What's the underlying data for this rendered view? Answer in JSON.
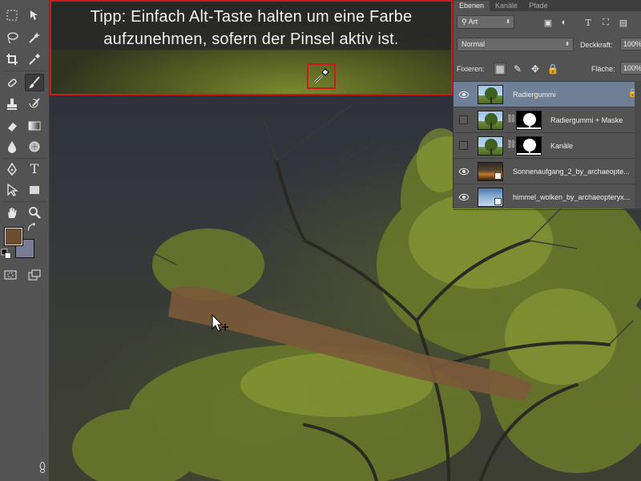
{
  "tip": {
    "line1": "Tipp: Einfach Alt-Taste halten um eine Farbe",
    "line2": "aufzunehmen, sofern der Pinsel aktiv ist."
  },
  "tools": {
    "foreground_color": "#6a4e30",
    "background_color": "#787c95",
    "items": [
      {
        "name": "marquee-tool-icon"
      },
      {
        "name": "move-tool-icon"
      },
      {
        "name": "lasso-tool-icon"
      },
      {
        "name": "magic-wand-tool-icon"
      },
      {
        "name": "crop-tool-icon"
      },
      {
        "name": "eyedropper-tool-icon"
      },
      {
        "name": "healing-brush-tool-icon"
      },
      {
        "name": "brush-tool-icon"
      },
      {
        "name": "clone-stamp-tool-icon"
      },
      {
        "name": "history-brush-tool-icon"
      },
      {
        "name": "eraser-tool-icon"
      },
      {
        "name": "gradient-tool-icon"
      },
      {
        "name": "blur-tool-icon"
      },
      {
        "name": "dodge-tool-icon"
      },
      {
        "name": "pen-tool-icon"
      },
      {
        "name": "type-tool-icon"
      },
      {
        "name": "path-selection-tool-icon"
      },
      {
        "name": "rectangle-tool-icon"
      },
      {
        "name": "hand-tool-icon"
      },
      {
        "name": "zoom-tool-icon"
      }
    ],
    "type_glyph": "T"
  },
  "panel": {
    "tabs": [
      "Ebenen",
      "Kanäle",
      "Pfade"
    ],
    "filter_kind": "Art",
    "blend_mode": "Normal",
    "opacity_label": "Deckkraft:",
    "opacity_value": "100%",
    "lock_label": "Fixieren:",
    "fill_label": "Fläche:",
    "fill_value": "100%"
  },
  "layers": [
    {
      "name": "Radiergummi",
      "visible": true,
      "selected": true,
      "thumb": "tree",
      "mask": false,
      "locked": true
    },
    {
      "name": "Radiergummi + Maske",
      "visible": false,
      "selected": false,
      "thumb": "tree",
      "mask": true,
      "locked": false
    },
    {
      "name": "Kanäle",
      "visible": false,
      "selected": false,
      "thumb": "tree",
      "mask": true,
      "locked": false
    },
    {
      "name": "Sonnenaufgang_2_by_archaeopte...",
      "visible": true,
      "selected": false,
      "thumb": "sun",
      "mask": false,
      "locked": false
    },
    {
      "name": "himmel_wolken_by_archaeopteryx...",
      "visible": true,
      "selected": false,
      "thumb": "sky",
      "mask": false,
      "locked": false
    }
  ]
}
